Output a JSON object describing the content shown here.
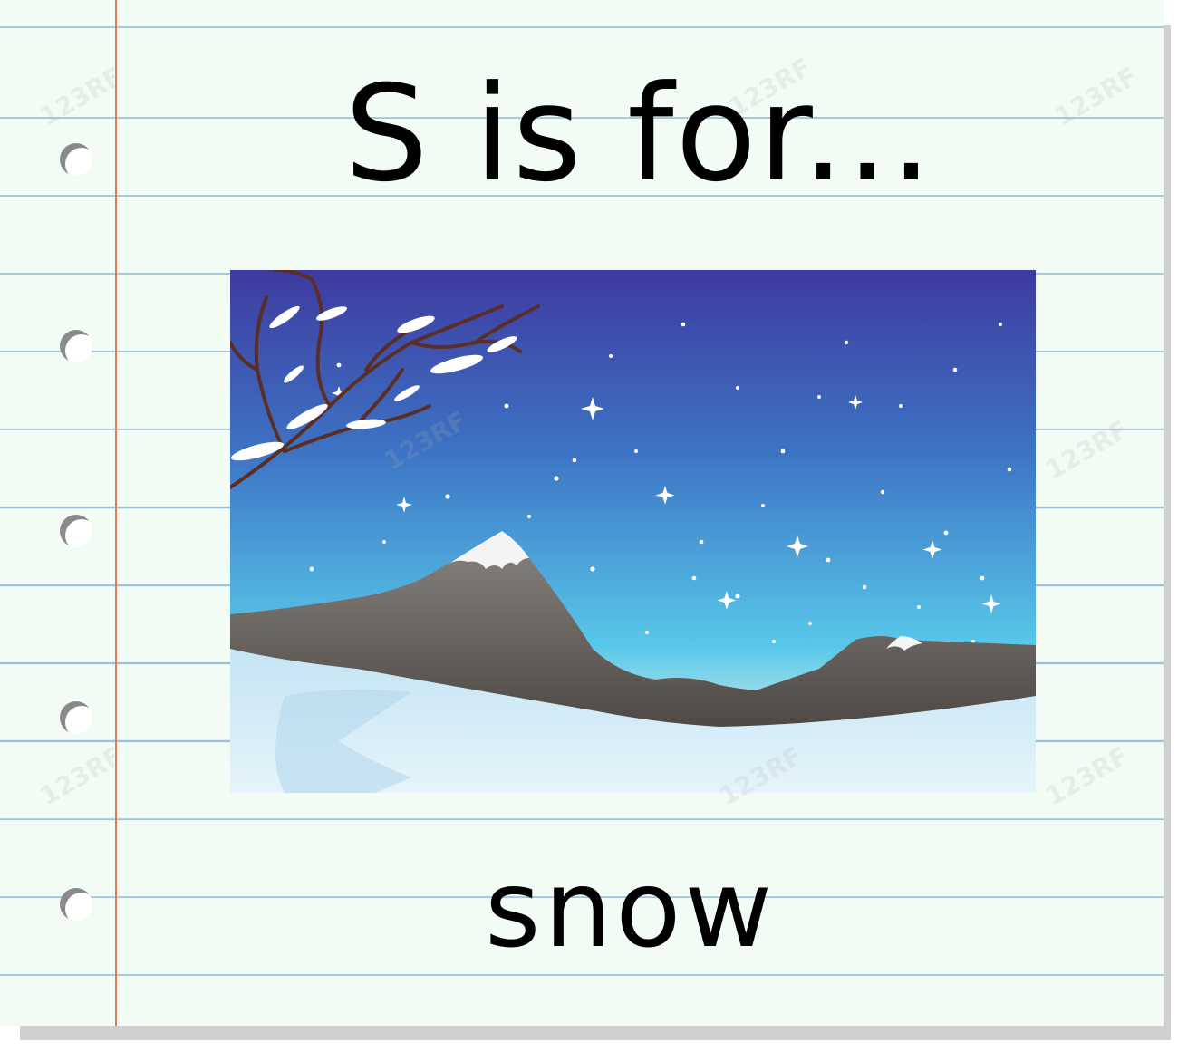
{
  "flashcard": {
    "heading": "S is for...",
    "word": "snow"
  },
  "watermark": {
    "text": "123RF"
  },
  "colors": {
    "paper": "#f2fbf4",
    "rule_line": "#9fc0dc",
    "margin_line": "#e07c5c",
    "sky_top": "#3e3aa0",
    "sky_bottom": "#5cd2ec",
    "mountain": "#6e6864",
    "snow_ground": "#d8eef8",
    "text": "#000000"
  },
  "illustration": {
    "subject": "snowy-landscape",
    "elements": [
      "night-sky",
      "snowflakes",
      "bare-tree-with-snow",
      "snow-capped-mountains",
      "snowy-ground"
    ]
  }
}
